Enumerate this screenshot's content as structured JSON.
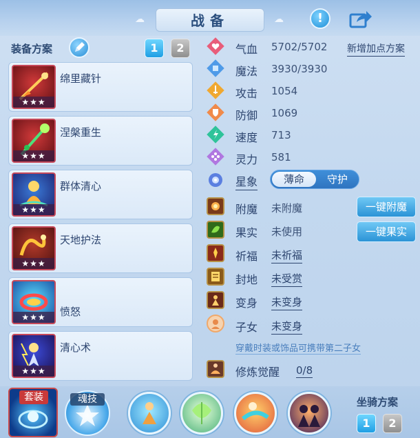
{
  "title": "战备",
  "header": {
    "alert_icon": "exclamation-icon",
    "share_icon": "share-icon",
    "alert_symbol": "!"
  },
  "equipment_scheme": {
    "label": "装备方案",
    "tabs": [
      "1",
      "2"
    ],
    "active_tab": "1"
  },
  "skills": [
    {
      "name": "绵里藏针",
      "stars": "★★★",
      "icon": "red-needle-icon"
    },
    {
      "name": "涅槃重生",
      "stars": "★★★",
      "icon": "green-staff-icon"
    },
    {
      "name": "群体清心",
      "stars": "★★★",
      "icon": "lotus-figure-icon"
    },
    {
      "name": "天地护法",
      "stars": "★★★",
      "icon": "golden-dragon-icon"
    },
    {
      "name": "愤怒",
      "stars": "★★★",
      "icon": "rage-ring-icon"
    },
    {
      "name": "清心术",
      "stars": "★★★",
      "icon": "lightning-figure-icon"
    }
  ],
  "stats": [
    {
      "label": "气血",
      "value": "5702/5702",
      "icon": "heart-icon",
      "color": "#e85d7a"
    },
    {
      "label": "魔法",
      "value": "3930/3930",
      "icon": "mana-icon",
      "color": "#4f9be8"
    },
    {
      "label": "攻击",
      "value": "1054",
      "icon": "sword-icon",
      "color": "#f0a830"
    },
    {
      "label": "防御",
      "value": "1069",
      "icon": "shield-icon",
      "color": "#f08a4a"
    },
    {
      "label": "速度",
      "value": "713",
      "icon": "speed-icon",
      "color": "#2fc39a"
    },
    {
      "label": "灵力",
      "value": "581",
      "icon": "spirit-icon",
      "color": "#b077e0"
    }
  ],
  "add_points_link": "新增加点方案",
  "star_sign": {
    "label": "星象",
    "options": [
      "薄命",
      "守护"
    ],
    "selected": "薄命"
  },
  "attributes": [
    {
      "label": "附魔",
      "value": "未附魔",
      "icon": "enchant-icon",
      "underline": false
    },
    {
      "label": "果实",
      "value": "未使用",
      "icon": "fruit-icon",
      "underline": false
    },
    {
      "label": "祈福",
      "value": "未祈福",
      "icon": "blessing-icon",
      "underline": true
    },
    {
      "label": "封地",
      "value": "未受赏",
      "icon": "fief-icon",
      "underline": true
    },
    {
      "label": "变身",
      "value": "未变身",
      "icon": "transform-icon",
      "underline": true
    },
    {
      "label": "子女",
      "value": "未变身",
      "icon": "child-icon",
      "underline": true
    }
  ],
  "actions": {
    "enchant": "一键附魔",
    "fruit": "一键果实"
  },
  "hint_text": "穿戴时装或饰品可携带第二子女",
  "cultivation": {
    "label": "修炼觉醒",
    "value": "0/8",
    "icon": "meditation-icon"
  },
  "bottom": {
    "suit_label": "套装",
    "soul_label": "魂技",
    "slots": [
      "monk-slot-icon",
      "leaf-slot-icon",
      "dancer-slot-icon",
      "warrior-slot-icon"
    ]
  },
  "mount_scheme": {
    "label": "坐骑方案",
    "tabs": [
      "1",
      "2"
    ],
    "active_tab": "1"
  }
}
